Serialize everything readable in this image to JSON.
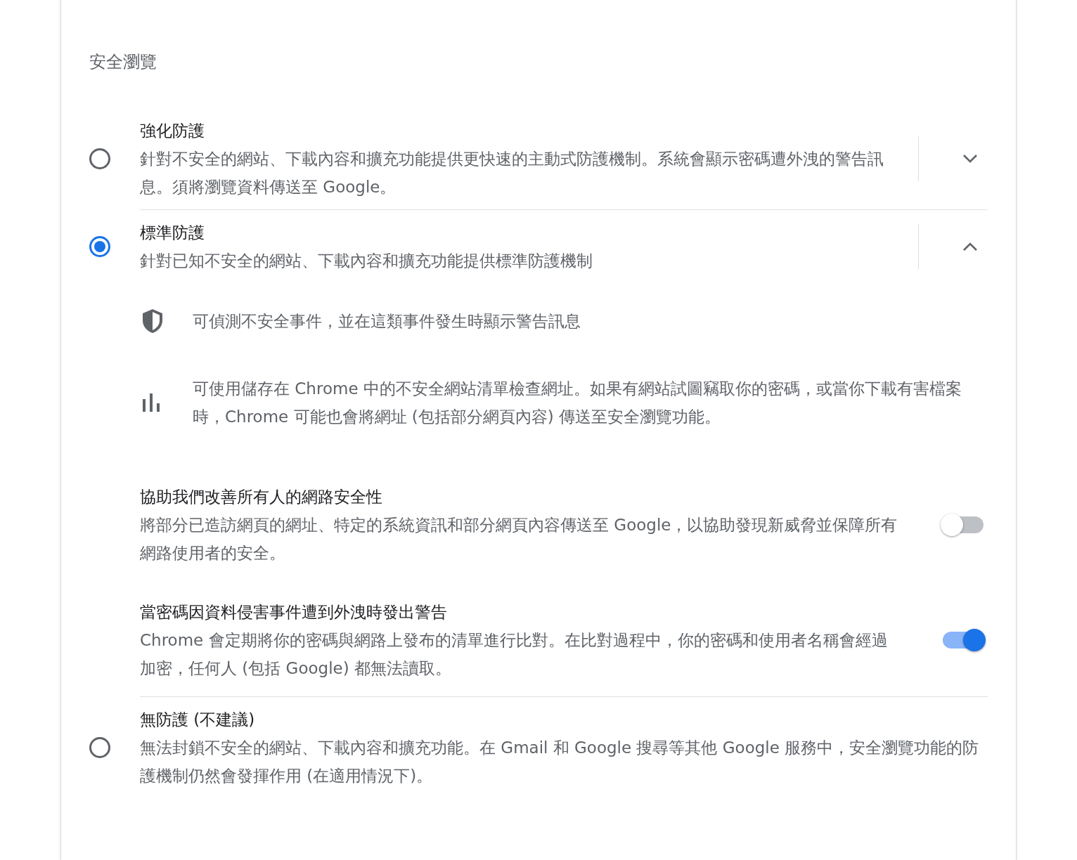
{
  "section_title": "安全瀏覽",
  "options": [
    {
      "kind": "expandable",
      "title": "強化防護",
      "description": "針對不安全的網站、下載內容和擴充功能提供更快速的主動式防護機制。系統會顯示密碼遭外洩的警告訊息。須將瀏覽資料傳送至 Google。",
      "selected": false,
      "expanded": false
    },
    {
      "kind": "expandable",
      "title": "標準防護",
      "description": "針對已知不安全的網站、下載內容和擴充功能提供標準防護機制",
      "selected": true,
      "expanded": true,
      "details": [
        {
          "kind": "shield",
          "text": "可偵測不安全事件，並在這類事件發生時顯示警告訊息"
        },
        {
          "kind": "chart",
          "text": "可使用儲存在 Chrome 中的不安全網站清單檢查網址。如果有網站試圖竊取你的密碼，或當你下載有害檔案時，Chrome 可能也會將網址 (包括部分網頁內容) 傳送至安全瀏覽功能。"
        }
      ],
      "settings": [
        {
          "title": "協助我們改善所有人的網路安全性",
          "description": "將部分已造訪網頁的網址、特定的系統資訊和部分網頁內容傳送至 Google，以協助發現新威脅並保障所有網路使用者的安全。",
          "on": false
        },
        {
          "title": "當密碼因資料侵害事件遭到外洩時發出警告",
          "description": "Chrome 會定期將你的密碼與網路上發布的清單進行比對。在比對過程中，你的密碼和使用者名稱會經過加密，任何人 (包括 Google) 都無法讀取。",
          "on": true
        }
      ]
    },
    {
      "kind": "plain",
      "title": "無防護 (不建議)",
      "description": "無法封鎖不安全的網站、下載內容和擴充功能。在 Gmail 和 Google 搜尋等其他 Google 服務中，安全瀏覽功能的防護機制仍然會發揮作用 (在適用情況下)。",
      "selected": false
    }
  ]
}
